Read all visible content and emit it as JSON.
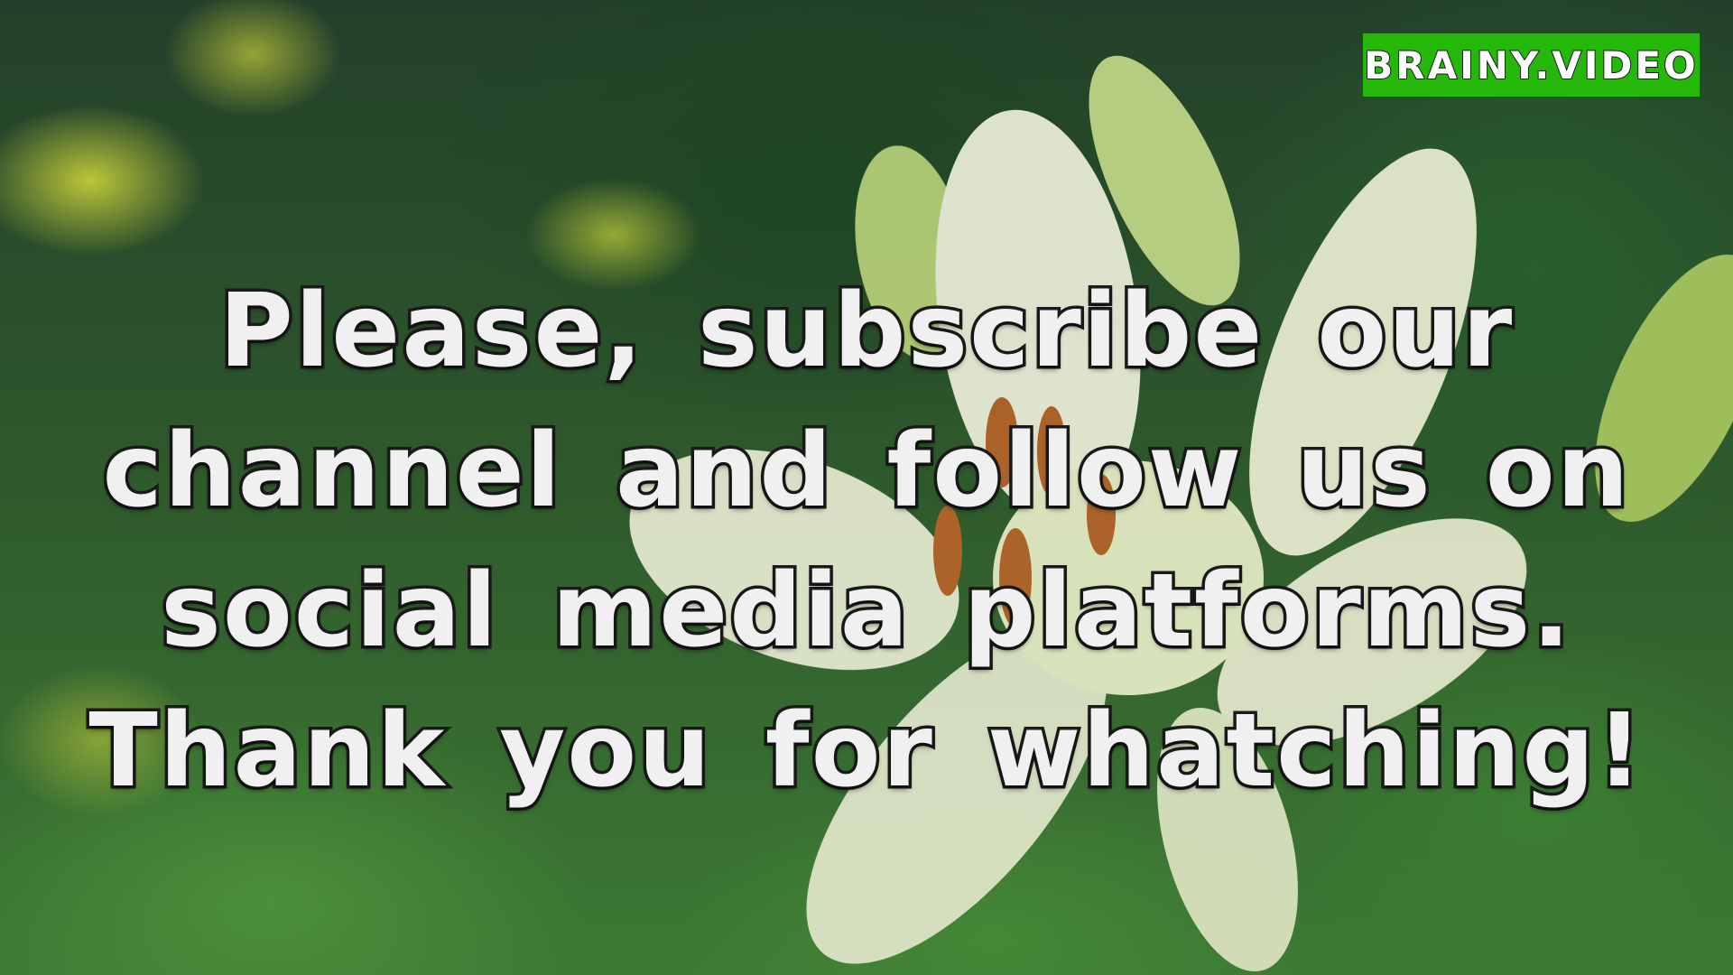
{
  "logo": {
    "text": "BRAINY.VIDEO",
    "background": "#25b80a"
  },
  "message": {
    "lines": [
      "Please, subscribe our",
      "channel and follow us on",
      "social media platforms.",
      "Thank you for whatching!"
    ]
  }
}
